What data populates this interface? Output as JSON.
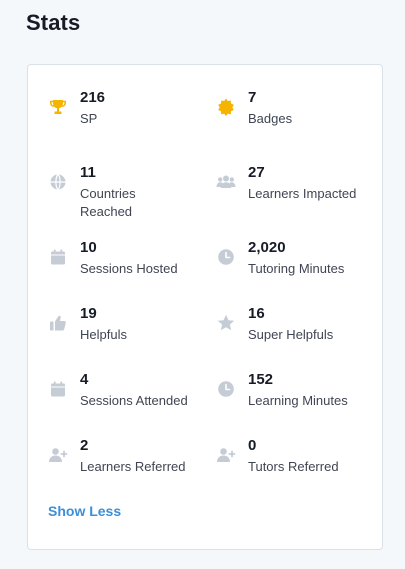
{
  "header": {
    "title": "Stats"
  },
  "stats": [
    {
      "value": "216",
      "label": "SP",
      "icon": "trophy-icon"
    },
    {
      "value": "7",
      "label": "Badges",
      "icon": "badge-icon"
    },
    {
      "value": "11",
      "label": "Countries Reached",
      "icon": "globe-icon"
    },
    {
      "value": "27",
      "label": "Learners Impacted",
      "icon": "people-icon"
    },
    {
      "value": "10",
      "label": "Sessions Hosted",
      "icon": "calendar-icon"
    },
    {
      "value": "2,020",
      "label": "Tutoring Minutes",
      "icon": "clock-icon"
    },
    {
      "value": "19",
      "label": "Helpfuls",
      "icon": "thumbs-up-icon"
    },
    {
      "value": "16",
      "label": "Super Helpfuls",
      "icon": "star-icon"
    },
    {
      "value": "4",
      "label": "Sessions Attended",
      "icon": "calendar-icon"
    },
    {
      "value": "152",
      "label": "Learning Minutes",
      "icon": "clock-icon"
    },
    {
      "value": "2",
      "label": "Learners Referred",
      "icon": "add-user-icon"
    },
    {
      "value": "0",
      "label": "Tutors Referred",
      "icon": "add-user-icon"
    }
  ],
  "actions": {
    "show_less_label": "Show Less"
  },
  "colors": {
    "accent": "#3b8fd9",
    "trophy": "#f5b400",
    "icon_muted": "#c6ccd6",
    "background": "#f5f8fb"
  }
}
